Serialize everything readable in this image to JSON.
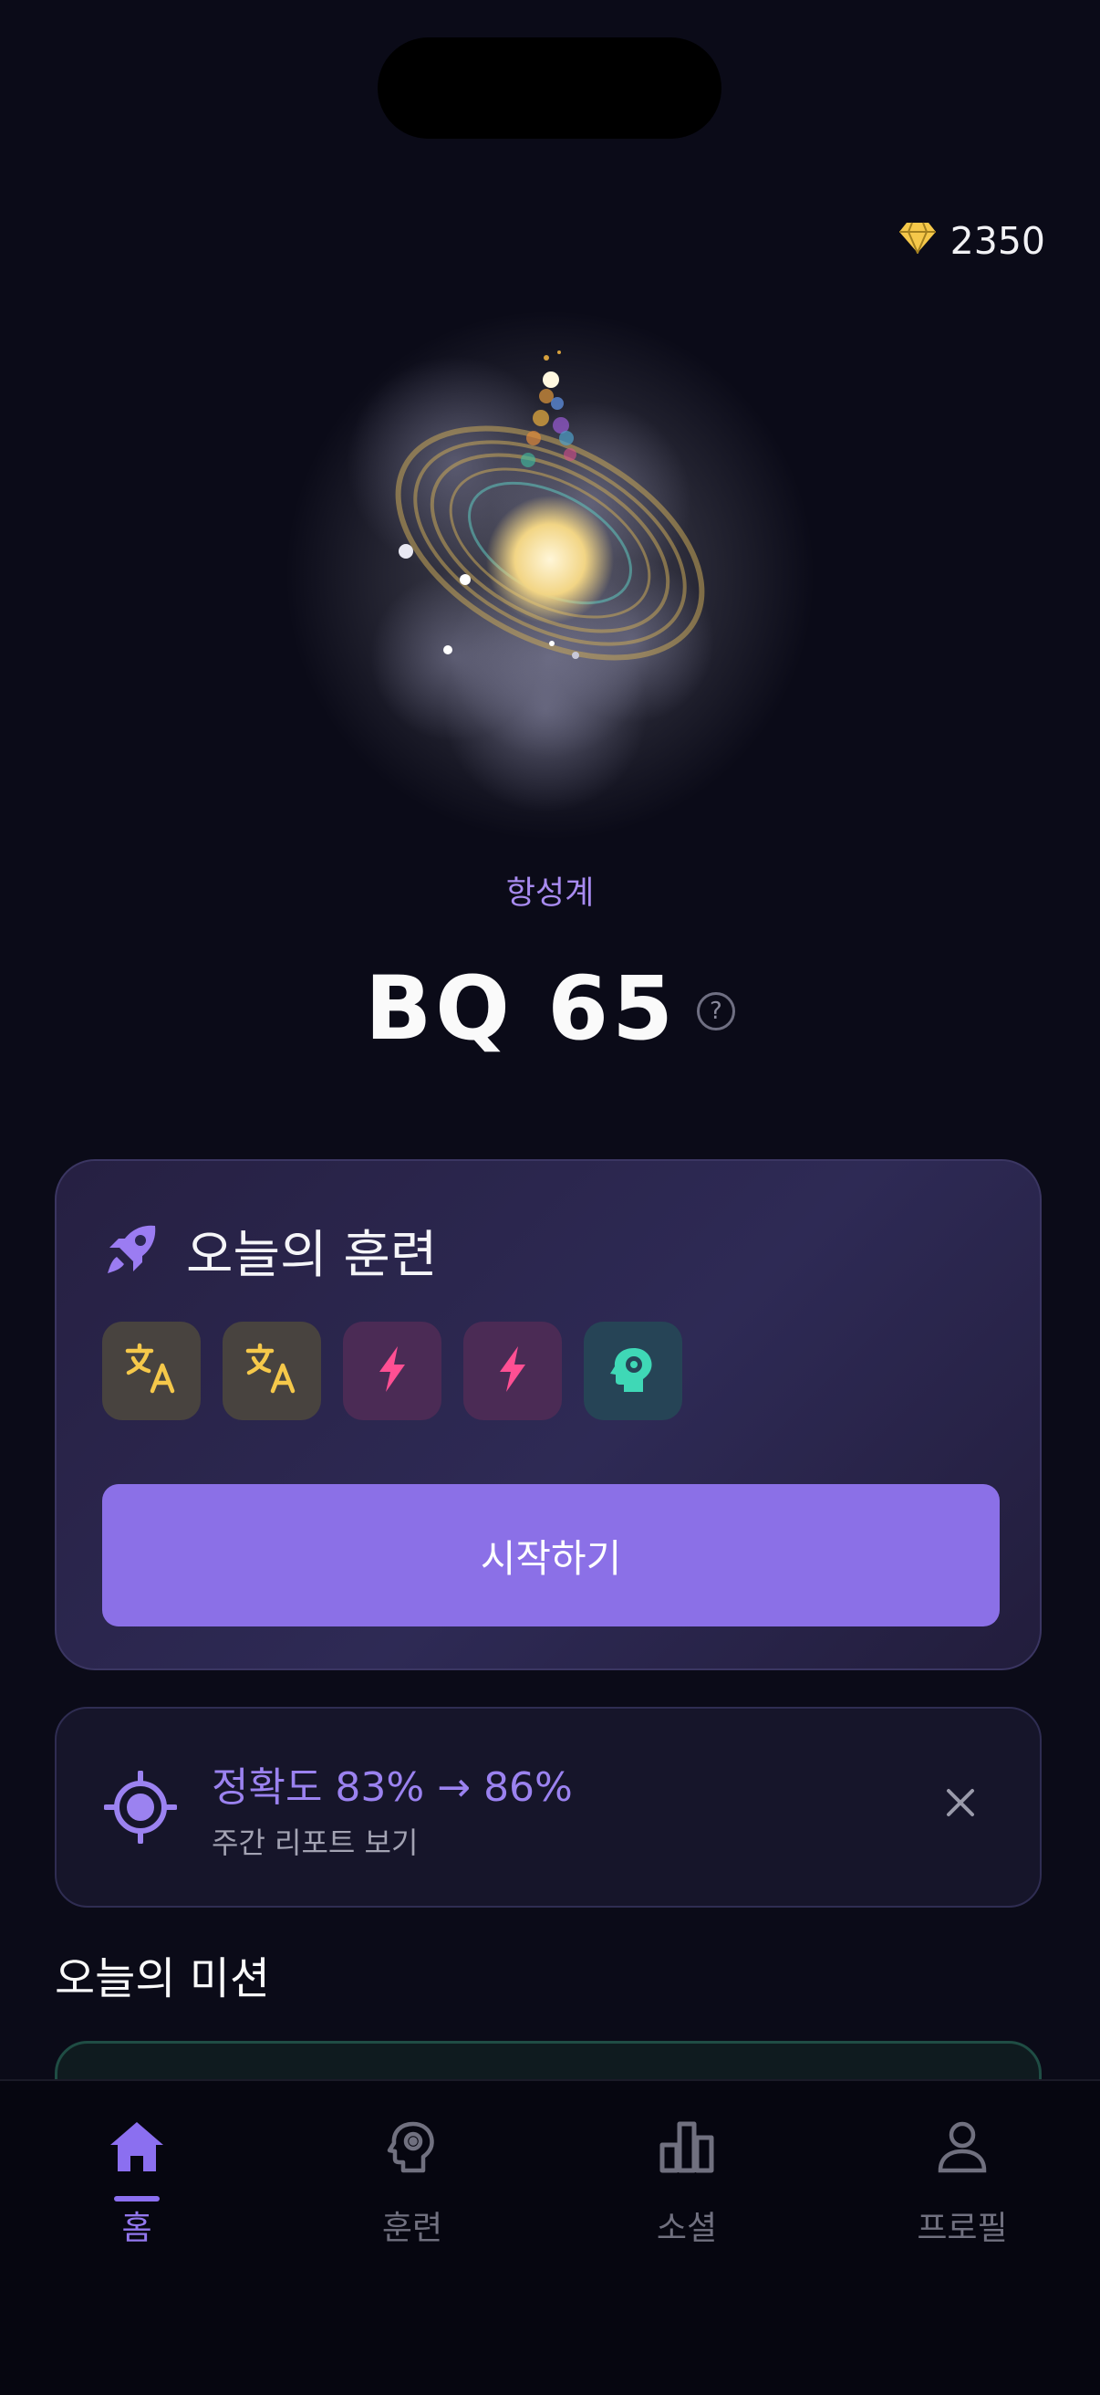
{
  "header": {
    "gem_icon": "diamond-icon",
    "gem_count": "2350"
  },
  "hero": {
    "stage_name": "항성계",
    "score_label": "BQ 65"
  },
  "training_card": {
    "title": "오늘의 훈련",
    "icon": "rocket-icon",
    "chips": [
      {
        "icon": "translate-icon",
        "color": "#f5c84a"
      },
      {
        "icon": "translate-icon",
        "color": "#f5c84a"
      },
      {
        "icon": "lightning-icon",
        "color": "#ff4f93"
      },
      {
        "icon": "lightning-icon",
        "color": "#ff4f93"
      },
      {
        "icon": "brain-gear-icon",
        "color": "#3fd8b6"
      }
    ],
    "start_label": "시작하기",
    "accent": "#8b70e7"
  },
  "accuracy_card": {
    "icon": "target-icon",
    "title": "정확도 83% → 86%",
    "subtitle": "주간 리포트 보기"
  },
  "missions": {
    "title": "오늘의 미션"
  },
  "tabbar": {
    "items": [
      {
        "label": "홈",
        "icon": "home-icon",
        "active": true
      },
      {
        "label": "훈련",
        "icon": "brain-gear-icon",
        "active": false
      },
      {
        "label": "소셜",
        "icon": "bar-chart-icon",
        "active": false
      },
      {
        "label": "프로필",
        "icon": "person-icon",
        "active": false
      }
    ],
    "active_color": "#9377ee",
    "inactive_color": "#70707f"
  }
}
